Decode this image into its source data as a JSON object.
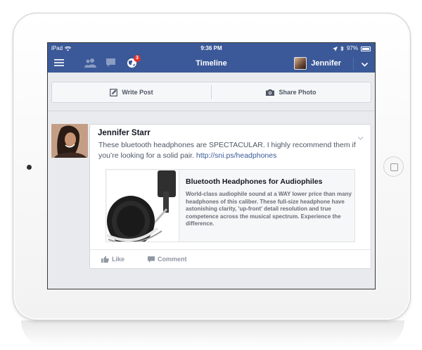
{
  "statusbar": {
    "device": "iPad",
    "time": "9:36 PM",
    "battery_text": "97%",
    "battery_level": 0.97
  },
  "navbar": {
    "title": "Timeline",
    "notification_count": "3",
    "user_name": "Jennifer"
  },
  "composer": {
    "write_post_label": "Write Post",
    "share_photo_label": "Share Photo"
  },
  "post": {
    "author": "Jennifer Starr",
    "text": "These bluetooth headphones are SPECTACULAR. I highly recommend them if you’re looking for a solid pair. ",
    "link_text": "http://sni.ps/headphones",
    "preview": {
      "title": "Bluetooth Headphones for Audiophiles",
      "description": "World-class audiophile sound at a WAY lower price than many headphones of this caliber. These full-size headphone have astonishing clarity, 'up-front' detail resolution and true competence across the musical spectrum. Experience the difference."
    },
    "actions": {
      "like_label": "Like",
      "comment_label": "Comment"
    }
  },
  "colors": {
    "facebook_blue": "#3b5998",
    "badge_red": "#e0322f",
    "background": "#e9eaed"
  }
}
